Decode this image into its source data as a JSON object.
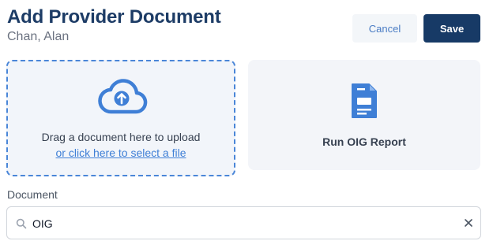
{
  "header": {
    "title": "Add Provider Document",
    "subtitle": "Chan, Alan",
    "cancel_label": "Cancel",
    "save_label": "Save"
  },
  "upload": {
    "icon": "cloud-upload-icon",
    "drag_text": "Drag a document here to upload",
    "link_text": "or click here to select a file"
  },
  "oig": {
    "icon": "document-icon",
    "label": "Run OIG Report"
  },
  "document_field": {
    "label": "Document",
    "value": "OIG",
    "search_icon": "search-icon",
    "clear_icon": "close-icon"
  },
  "colors": {
    "title": "#1d3c66",
    "save_bg": "#173a66",
    "accent": "#4a86d8",
    "link": "#3f7fd6"
  }
}
